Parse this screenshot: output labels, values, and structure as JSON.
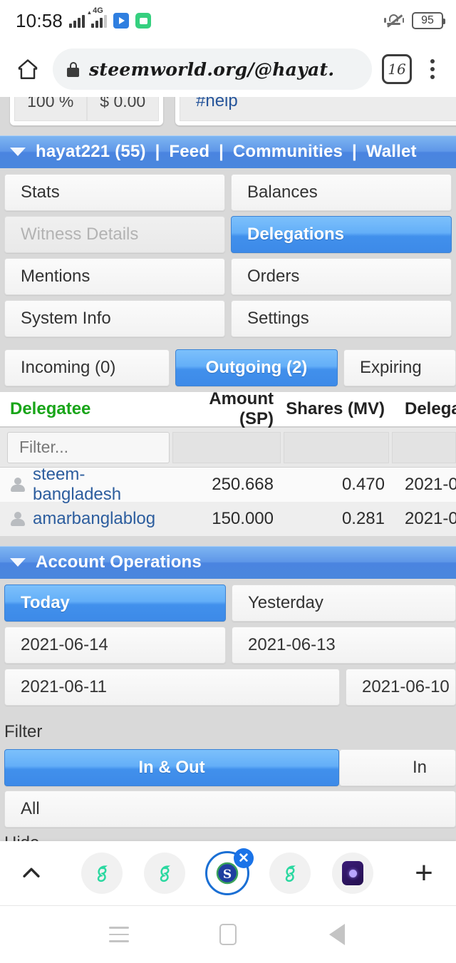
{
  "status_bar": {
    "time": "10:58",
    "network_label": "4G",
    "battery_level": "95",
    "icons": [
      "signal-bars-icon",
      "signal-bars-4g-icon",
      "play-store-icon",
      "messages-icon",
      "vibrate-bell-icon",
      "battery-icon"
    ]
  },
  "browser": {
    "url": "steemworld.org/@hayat.",
    "tab_count": "16",
    "home_icon": "home-icon",
    "lock_icon": "lock-icon",
    "menu_icon": "kebab-menu-icon"
  },
  "partial_card": {
    "percent": "100 %",
    "value": "$ 0.00",
    "tag": "#help"
  },
  "account_bar": {
    "username": "hayat221 (55)",
    "links": [
      "Feed",
      "Communities",
      "Wallet"
    ],
    "separator": "|",
    "caret": "caret-down-icon"
  },
  "nav_buttons": [
    {
      "label": "Stats",
      "state": "normal"
    },
    {
      "label": "Balances",
      "state": "normal"
    },
    {
      "label": "Witness Details",
      "state": "disabled"
    },
    {
      "label": "Delegations",
      "state": "active"
    },
    {
      "label": "Mentions",
      "state": "normal"
    },
    {
      "label": "Orders",
      "state": "normal"
    },
    {
      "label": "System Info",
      "state": "normal"
    },
    {
      "label": "Settings",
      "state": "normal"
    }
  ],
  "delegation_tabs": [
    {
      "label": "Incoming (0)",
      "state": "normal"
    },
    {
      "label": "Outgoing (2)",
      "state": "active"
    },
    {
      "label": "Expiring",
      "state": "normal"
    }
  ],
  "table": {
    "columns": [
      "Delegatee",
      "Amount (SP)",
      "Shares (MV)",
      "Delega"
    ],
    "sorted_column": "Delegatee",
    "sorted_color": "#19a519",
    "filter_placeholder": "Filter...",
    "rows": [
      {
        "delegatee": "steem-bangladesh",
        "amount": "250.668",
        "shares": "0.470",
        "delegated": "2021-0"
      },
      {
        "delegatee": "amarbanglablog",
        "amount": "150.000",
        "shares": "0.281",
        "delegated": "2021-0"
      }
    ]
  },
  "account_operations": {
    "title": "Account Operations",
    "caret": "caret-down-icon",
    "date_buttons": [
      {
        "label": "Today",
        "state": "active"
      },
      {
        "label": "Yesterday",
        "state": "normal"
      },
      {
        "label": "2021-06-14",
        "state": "normal"
      },
      {
        "label": "2021-06-13",
        "state": "normal"
      },
      {
        "label": "2021-06-11",
        "state": "normal"
      },
      {
        "label": "2021-06-10",
        "state": "normal"
      }
    ],
    "filter_label": "Filter",
    "filter_buttons": [
      {
        "label": "In & Out",
        "state": "active"
      },
      {
        "label": "In",
        "state": "normal"
      }
    ],
    "all_button": "All",
    "hide_label": "Hide"
  },
  "tab_strip": {
    "collapse_icon": "chevron-up-icon",
    "new_tab_icon": "plus-icon",
    "close_icon": "close-icon",
    "tabs": [
      {
        "icon": "steemit-green-icon",
        "selected": false
      },
      {
        "icon": "steemit-green-icon",
        "selected": false
      },
      {
        "icon": "steem-blue-icon",
        "selected": true
      },
      {
        "icon": "steemit-green-icon",
        "selected": false
      },
      {
        "icon": "purple-app-icon",
        "selected": false
      }
    ]
  },
  "android_nav": {
    "recents": "recents-icon",
    "home": "home-square-icon",
    "back": "back-triangle-icon"
  },
  "colors": {
    "accent_blue": "#4a8ae6",
    "link_blue": "#2c5d9e",
    "sort_green": "#19a519",
    "page_bg": "#d9d9d9"
  }
}
